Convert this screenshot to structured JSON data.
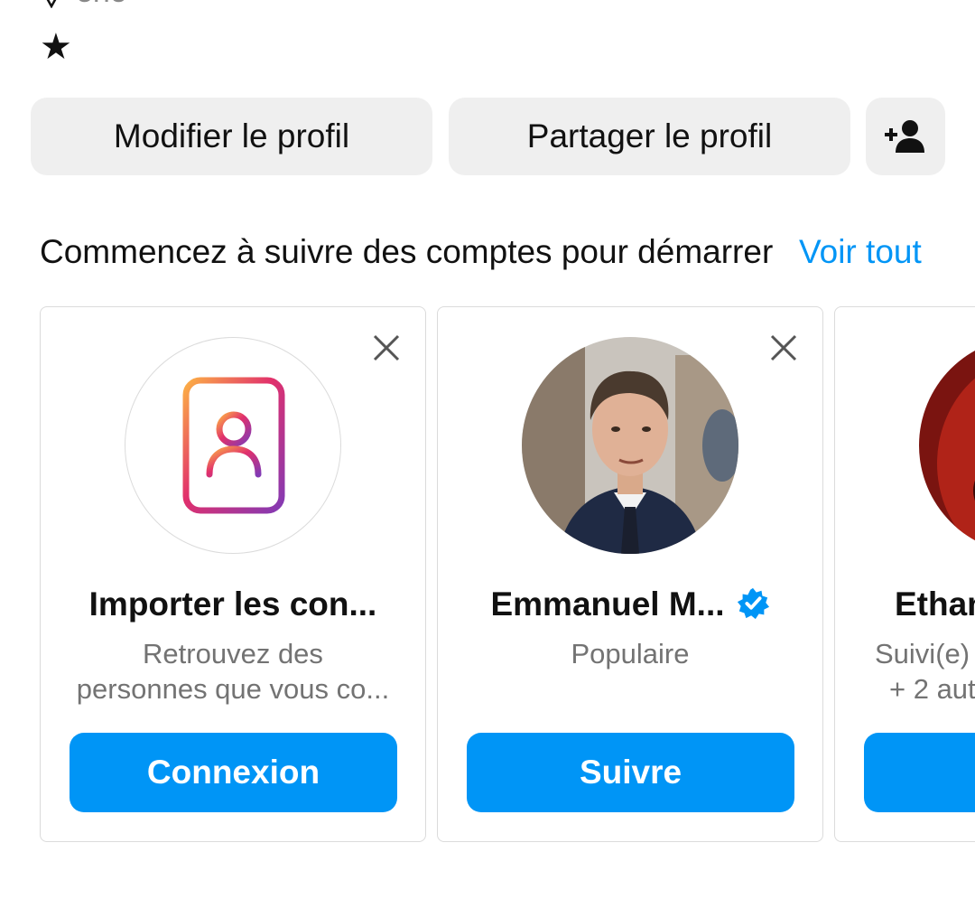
{
  "header": {
    "partial_text": "eho",
    "star": "★"
  },
  "actions": {
    "edit_profile": "Modifier le profil",
    "share_profile": "Partager le profil",
    "add_user_icon": "add-person-icon"
  },
  "suggestions": {
    "title": "Commencez à suivre des comptes pour démarrer",
    "see_all": "Voir tout",
    "cards": [
      {
        "name": "Importer les con...",
        "subtitle_line1": "Retrouvez des",
        "subtitle_line2": "personnes que vous co...",
        "button": "Connexion",
        "icon": "contacts-book-icon"
      },
      {
        "name": "Emmanuel M...",
        "verified": true,
        "subtitle_line1": "Populaire",
        "button": "Suivre"
      },
      {
        "name": "Ethan",
        "subtitle_line1": "Suivi(e)",
        "subtitle_line2": "+ 2 aut"
      }
    ]
  },
  "colors": {
    "accent": "#0095f6",
    "button_gray": "#efefef",
    "border": "#dbdbdb",
    "muted_text": "#737373"
  }
}
